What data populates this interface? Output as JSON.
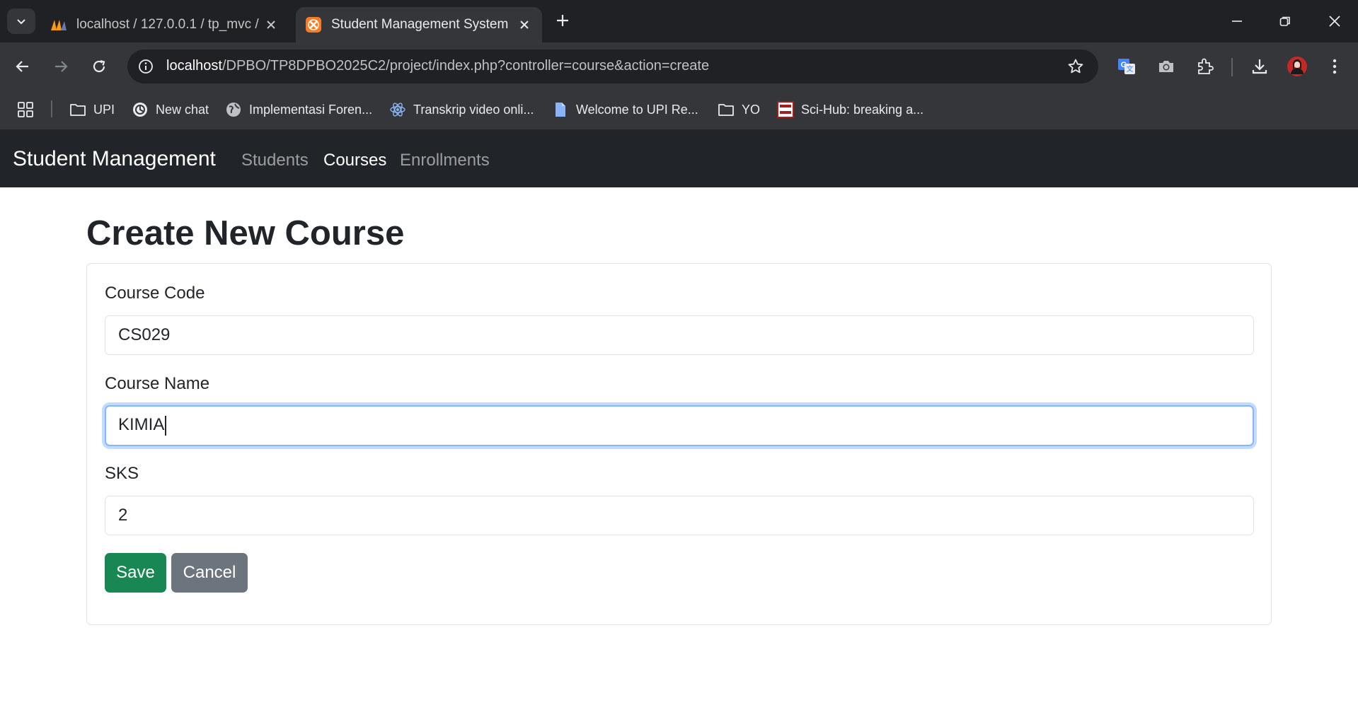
{
  "browser": {
    "tabs": [
      {
        "title": "localhost / 127.0.0.1 / tp_mvc / ",
        "active": false,
        "favicon": "phpmyadmin-icon"
      },
      {
        "title": "Student Management System",
        "active": true,
        "favicon": "xampp-icon"
      }
    ],
    "url_host": "localhost",
    "url_path": "/DPBO/TP8DPBO2025C2/project/index.php?controller=course&action=create",
    "bookmarks": [
      {
        "label": "UPI",
        "icon": "folder-icon"
      },
      {
        "label": "New chat",
        "icon": "openai-icon"
      },
      {
        "label": "Implementasi Foren...",
        "icon": "globe-icon"
      },
      {
        "label": "Transkrip video onli...",
        "icon": "react-icon"
      },
      {
        "label": "Welcome to UPI Re...",
        "icon": "document-icon"
      },
      {
        "label": "YO",
        "icon": "folder-icon"
      },
      {
        "label": "Sci-Hub: breaking a...",
        "icon": "scihub-icon"
      }
    ]
  },
  "app": {
    "brand": "Student Management",
    "nav": [
      {
        "label": "Students",
        "active": false
      },
      {
        "label": "Courses",
        "active": true
      },
      {
        "label": "Enrollments",
        "active": false
      }
    ]
  },
  "form": {
    "title": "Create New Course",
    "course_code_label": "Course Code",
    "course_code_value": "CS029",
    "course_name_label": "Course Name",
    "course_name_value": "KIMIA",
    "sks_label": "SKS",
    "sks_value": "2",
    "save_label": "Save",
    "cancel_label": "Cancel"
  },
  "colors": {
    "navbar_bg": "#212529",
    "save_button": "#198754",
    "cancel_button": "#6c757d",
    "focus_ring": "#86b7fe"
  }
}
